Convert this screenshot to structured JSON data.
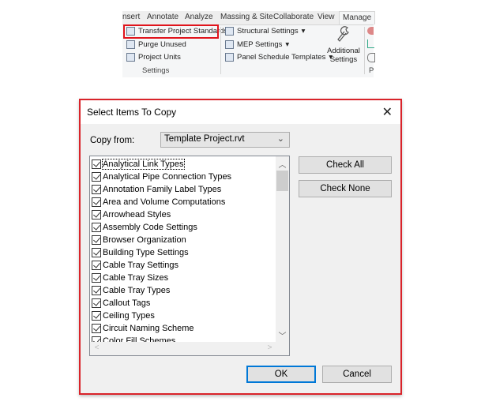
{
  "ribbon": {
    "tabs": [
      "nsert",
      "Annotate",
      "Analyze",
      "Massing & Site",
      "Collaborate",
      "View",
      "Manage"
    ],
    "active_tab": "Manage",
    "settings_items": [
      "Transfer Project Standards",
      "Purge Unused",
      "Project Units"
    ],
    "group_label": "Settings",
    "more_items": [
      "Structural Settings",
      "MEP Settings",
      "Panel Schedule Templates"
    ],
    "dropdown_glyph": "▾",
    "additional_settings": [
      "Additional",
      "Settings"
    ],
    "partial_group_label": "P"
  },
  "dialog": {
    "title": "Select Items To Copy",
    "close_glyph": "✕",
    "copy_from_label": "Copy from:",
    "copy_from_value": "Template Project.rvt",
    "items": [
      "Analytical Link Types",
      "Analytical Pipe Connection Types",
      "Annotation Family Label Types",
      "Area and Volume Computations",
      "Arrowhead Styles",
      "Assembly Code Settings",
      "Browser Organization",
      "Building Type Settings",
      "Cable Tray Settings",
      "Cable Tray Sizes",
      "Cable Tray Types",
      "Callout Tags",
      "Ceiling Types",
      "Circuit Naming Scheme",
      "Color Fill Schemes"
    ],
    "check_all_label": "Check All",
    "check_none_label": "Check None",
    "ok_label": "OK",
    "cancel_label": "Cancel",
    "scroll_glyphs": {
      "up": "︿",
      "down": "﹀",
      "left": "<",
      "right": ">"
    }
  }
}
